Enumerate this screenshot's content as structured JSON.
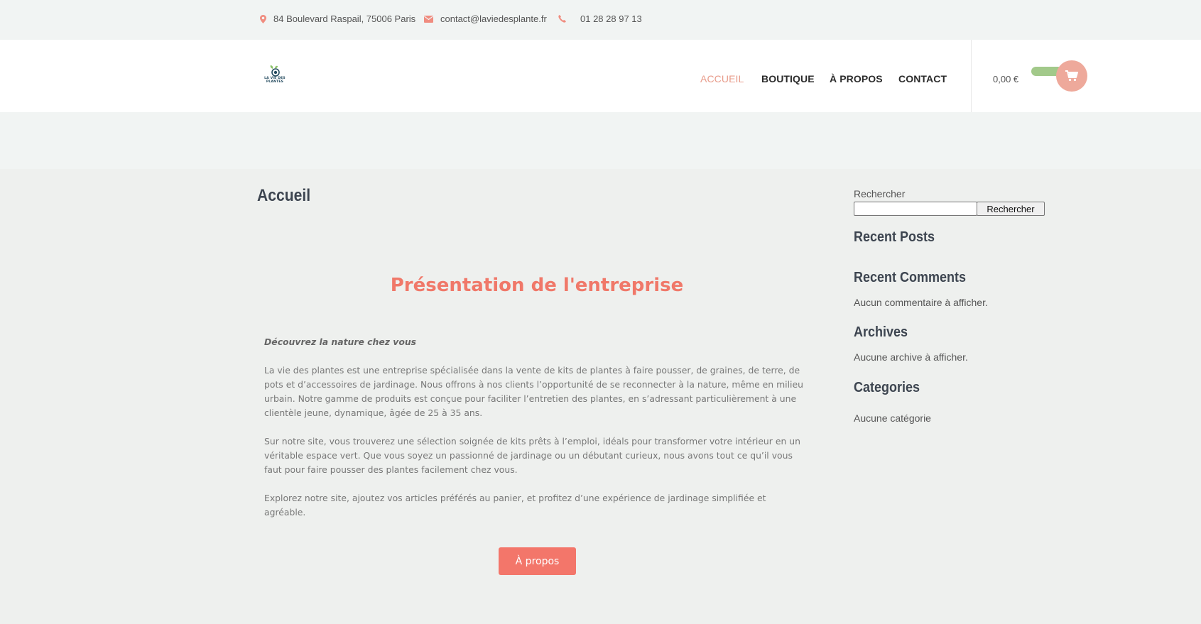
{
  "topbar": {
    "address": "84 Boulevard Raspail, 75006 Paris",
    "email": "contact@laviedesplante.fr",
    "phone": "01 28 28 97 13"
  },
  "header": {
    "logo_text": "LA VIE DES PLANTES",
    "nav": [
      {
        "label": "ACCUEIL",
        "active": true
      },
      {
        "label": "BOUTIQUE",
        "active": false
      },
      {
        "label": "À PROPOS",
        "active": false
      },
      {
        "label": "CONTACT",
        "active": false
      }
    ],
    "cart_total": "0,00 €"
  },
  "main": {
    "page_title": "Accueil",
    "section_heading": "Présentation de l'entreprise",
    "lead": "Découvrez la nature chez vous",
    "paragraphs": [
      "La vie des plantes est une entreprise spécialisée dans la vente de kits de plantes à faire pousser, de graines, de terre, de pots et d’accessoires de jardinage. Nous offrons à nos clients l’opportunité de se reconnecter à la nature, même en milieu urbain. Notre gamme de produits est conçue pour faciliter l’entretien des plantes, en s’adressant particulièrement à une clientèle jeune, dynamique, âgée de 25 à 35 ans.",
      "Sur notre site, vous trouverez une sélection soignée de kits prêts à l’emploi, idéals pour transformer votre intérieur en un véritable espace vert. Que vous soyez un passionné de jardinage ou un débutant curieux, nous avons tout ce qu’il vous faut pour faire pousser des plantes facilement chez vous.",
      "Explorez notre site, ajoutez vos articles préférés au panier, et profitez d’une expérience de jardinage simplifiée et agréable."
    ],
    "cta_label": "À propos"
  },
  "sidebar": {
    "search_label": "Rechercher",
    "search_value": "",
    "search_button": "Rechercher",
    "recent_posts_title": "Recent Posts",
    "recent_comments_title": "Recent Comments",
    "recent_comments_text": "Aucun commentaire à afficher.",
    "archives_title": "Archives",
    "archives_text": "Aucune archive à afficher.",
    "categories_title": "Categories",
    "categories_text": "Aucune catégorie"
  },
  "colors": {
    "accent": "#f3766a",
    "nav_active": "#e89c8b",
    "cart_circle": "#eea99b",
    "cart_pill": "#a2c98a"
  },
  "icons": [
    "map-pin-icon",
    "envelope-icon",
    "phone-icon",
    "shopping-cart-icon"
  ]
}
